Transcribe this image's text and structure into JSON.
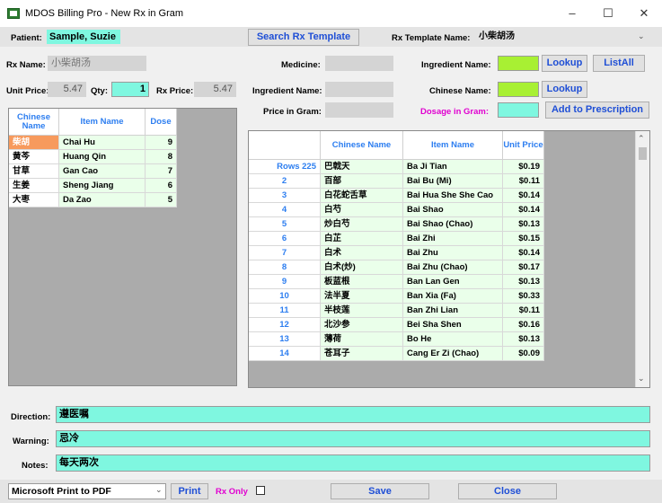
{
  "window": {
    "title": "MDOS Billing Pro - New Rx in Gram",
    "minimize": "–",
    "maximize": "☐",
    "close": "✕"
  },
  "patient": {
    "label": "Patient:",
    "value": "Sample, Suzie"
  },
  "search_template_button": "Search Rx Template",
  "rx_template": {
    "label": "Rx Template Name:",
    "value": "小柴胡汤"
  },
  "rx_name": {
    "label": "Rx Name:",
    "value": "小柴胡汤"
  },
  "unit_price": {
    "label": "Unit Price:",
    "value": "5.47"
  },
  "qty": {
    "label": "Qty:",
    "value": "1"
  },
  "rx_price": {
    "label": "Rx Price:",
    "value": "5.47"
  },
  "medicine": {
    "label": "Medicine:",
    "value": ""
  },
  "ingredient_name_mid": {
    "label": "Ingredient Name:",
    "value": ""
  },
  "price_in_gram": {
    "label": "Price in Gram:",
    "value": ""
  },
  "ingredient_name_right": {
    "label": "Ingredient Name:",
    "value": ""
  },
  "chinese_name_right": {
    "label": "Chinese Name:",
    "value": ""
  },
  "dosage_in_gram": {
    "label": "Dosage in Gram:",
    "value": ""
  },
  "buttons": {
    "lookup1": "Lookup",
    "listall": "ListAll",
    "lookup2": "Lookup",
    "add_to_prescription": "Add to Prescription"
  },
  "left_grid": {
    "headers": [
      "Chinese Name",
      "Item Name",
      "Dose"
    ],
    "rows": [
      {
        "cn": "柴胡",
        "name": "Chai Hu",
        "dose": "9"
      },
      {
        "cn": "黄芩",
        "name": "Huang Qin",
        "dose": "8"
      },
      {
        "cn": "甘草",
        "name": "Gan Cao",
        "dose": "7"
      },
      {
        "cn": "生姜",
        "name": "Sheng Jiang",
        "dose": "6"
      },
      {
        "cn": "大枣",
        "name": "Da Zao",
        "dose": "5"
      }
    ]
  },
  "right_grid": {
    "headers": [
      "",
      "Chinese Name",
      "Item Name",
      "Unit Price"
    ],
    "rows": [
      {
        "n": "Rows 225",
        "cn": "巴戟天",
        "name": "Ba Ji Tian",
        "price": "$0.19"
      },
      {
        "n": "2",
        "cn": "百部",
        "name": "Bai Bu (Mi)",
        "price": "$0.11"
      },
      {
        "n": "3",
        "cn": "白花蛇舌草",
        "name": "Bai Hua She She Cao",
        "price": "$0.14"
      },
      {
        "n": "4",
        "cn": "白芍",
        "name": "Bai Shao",
        "price": "$0.14"
      },
      {
        "n": "5",
        "cn": "炒白芍",
        "name": "Bai Shao (Chao)",
        "price": "$0.13"
      },
      {
        "n": "6",
        "cn": "白芷",
        "name": "Bai Zhi",
        "price": "$0.15"
      },
      {
        "n": "7",
        "cn": "白术",
        "name": "Bai Zhu",
        "price": "$0.14"
      },
      {
        "n": "8",
        "cn": "白术(炒)",
        "name": "Bai Zhu (Chao)",
        "price": "$0.17"
      },
      {
        "n": "9",
        "cn": "板蓝根",
        "name": "Ban Lan Gen",
        "price": "$0.13"
      },
      {
        "n": "10",
        "cn": "法半夏",
        "name": "Ban Xia (Fa)",
        "price": "$0.33"
      },
      {
        "n": "11",
        "cn": "半枝莲",
        "name": "Ban Zhi Lian",
        "price": "$0.11"
      },
      {
        "n": "12",
        "cn": "北沙参",
        "name": "Bei Sha Shen",
        "price": "$0.16"
      },
      {
        "n": "13",
        "cn": "薄荷",
        "name": "Bo He",
        "price": "$0.13"
      },
      {
        "n": "14",
        "cn": "苍耳子",
        "name": "Cang Er Zi (Chao)",
        "price": "$0.09"
      }
    ]
  },
  "direction": {
    "label": "Direction:",
    "value": "遵医嘱"
  },
  "warning": {
    "label": "Warning:",
    "value": "忌冷"
  },
  "notes": {
    "label": "Notes:",
    "value": "每天两次"
  },
  "bottom": {
    "printer": "Microsoft Print to PDF",
    "print": "Print",
    "rx_only": "Rx Only",
    "save": "Save",
    "close": "Close"
  }
}
